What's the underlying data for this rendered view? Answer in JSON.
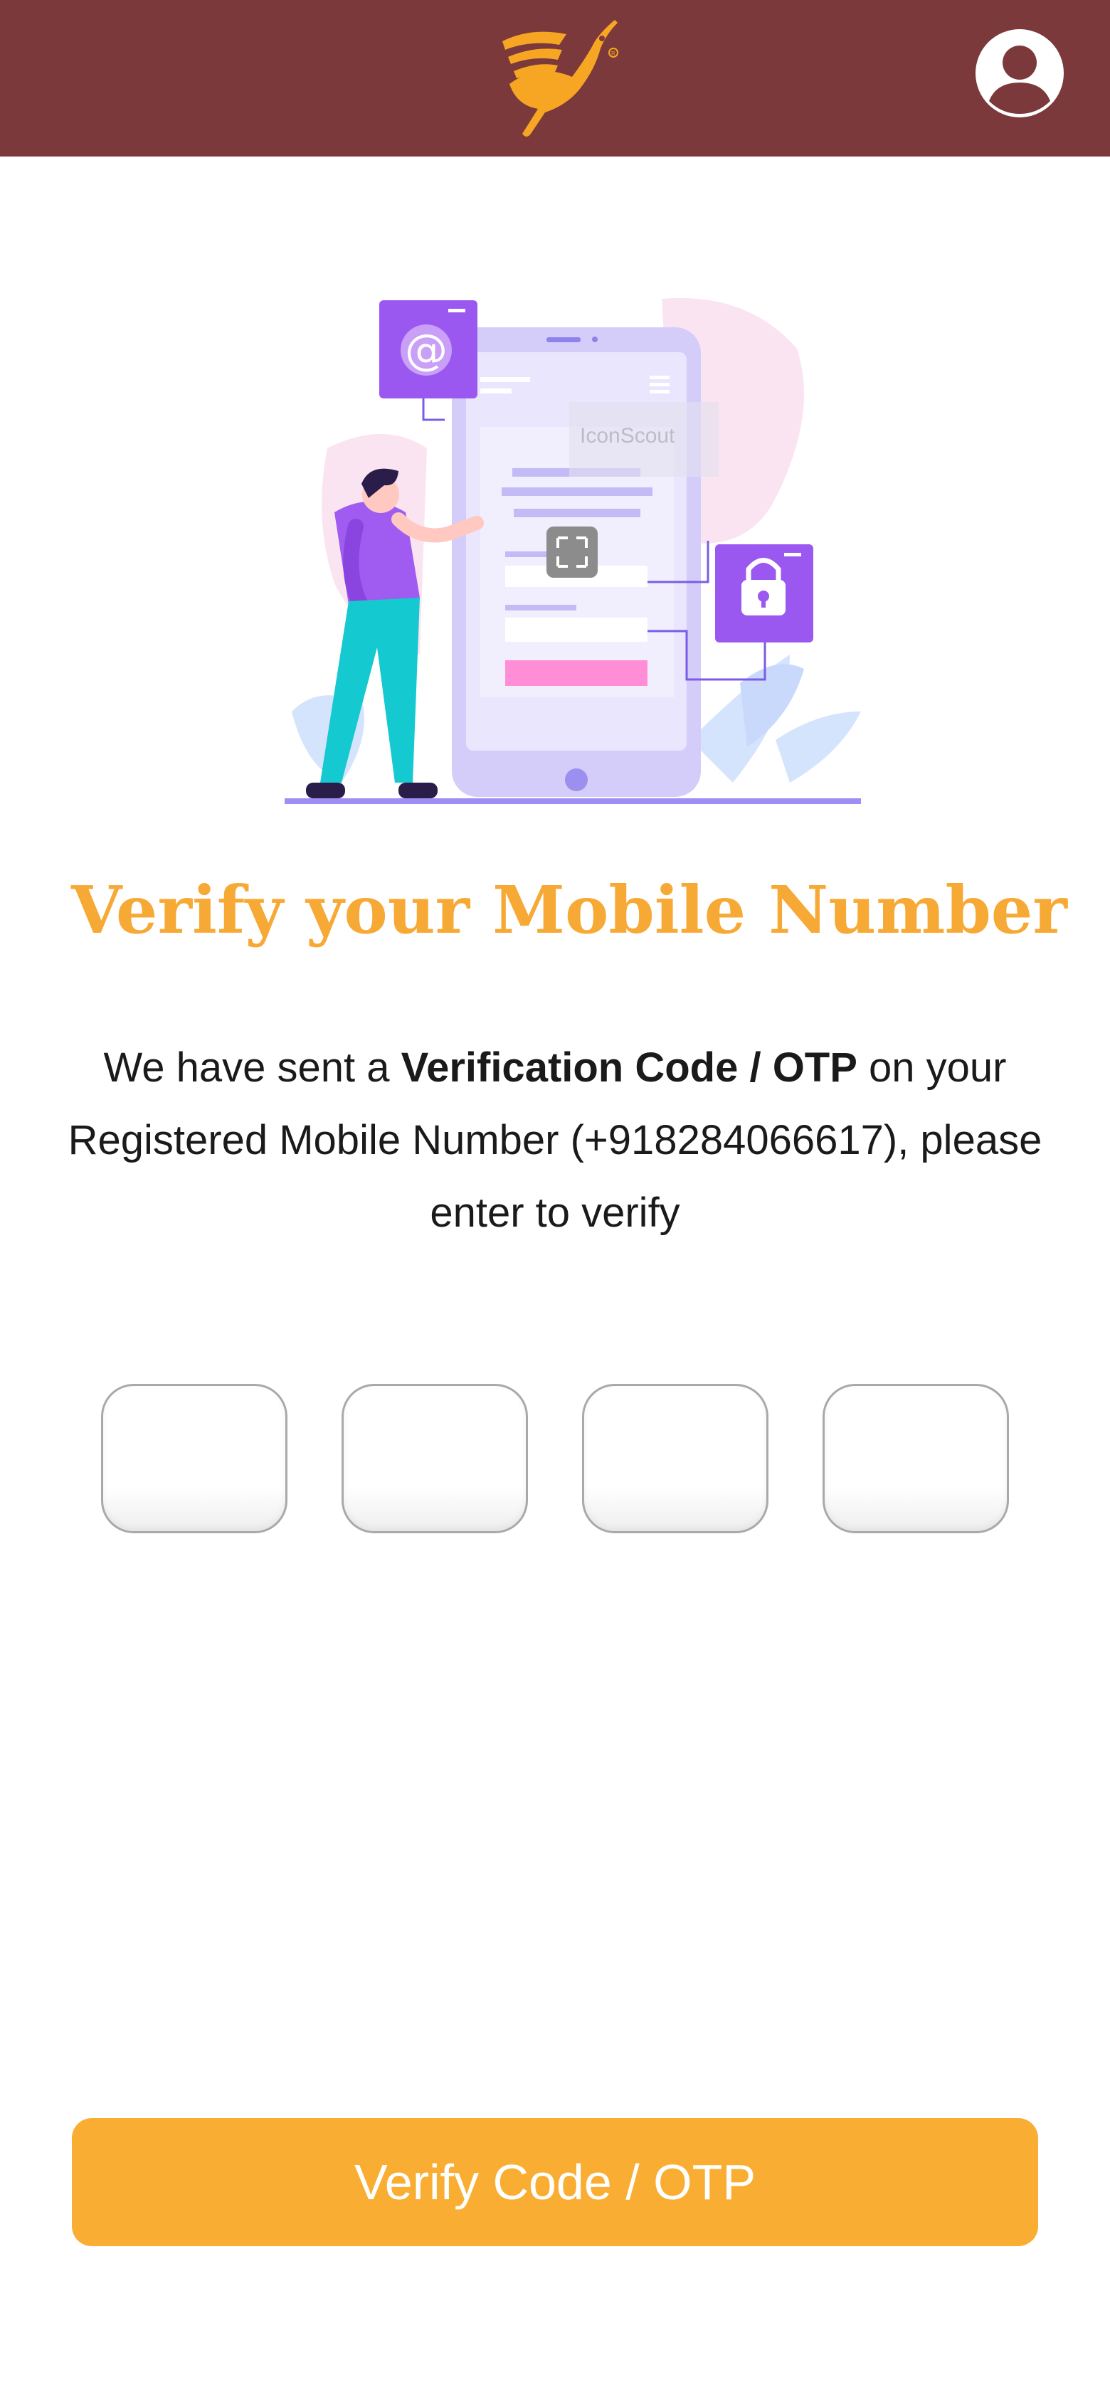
{
  "header": {
    "logo_icon": "bird-logo-icon",
    "profile_icon": "user-avatar-icon",
    "background_color": "#7c393b",
    "accent_color": "#f7a935"
  },
  "illustration": {
    "watermark_text": "IconScout",
    "icons": [
      "at-sign-icon",
      "lock-icon",
      "expand-icon",
      "phone-mockup",
      "person-figure"
    ]
  },
  "main": {
    "title": "Verify your Mobile Number",
    "description": {
      "part1": "We have sent a ",
      "bold": "Verification Code / OTP",
      "part2": " on your Registered Mobile Number (+918284066617), please enter to verify"
    },
    "otp_fields": [
      {
        "value": "",
        "placeholder": ""
      },
      {
        "value": "",
        "placeholder": ""
      },
      {
        "value": "",
        "placeholder": ""
      },
      {
        "value": "",
        "placeholder": ""
      }
    ]
  },
  "footer": {
    "verify_button_label": "Verify Code / OTP",
    "button_color": "#f9ae33"
  }
}
